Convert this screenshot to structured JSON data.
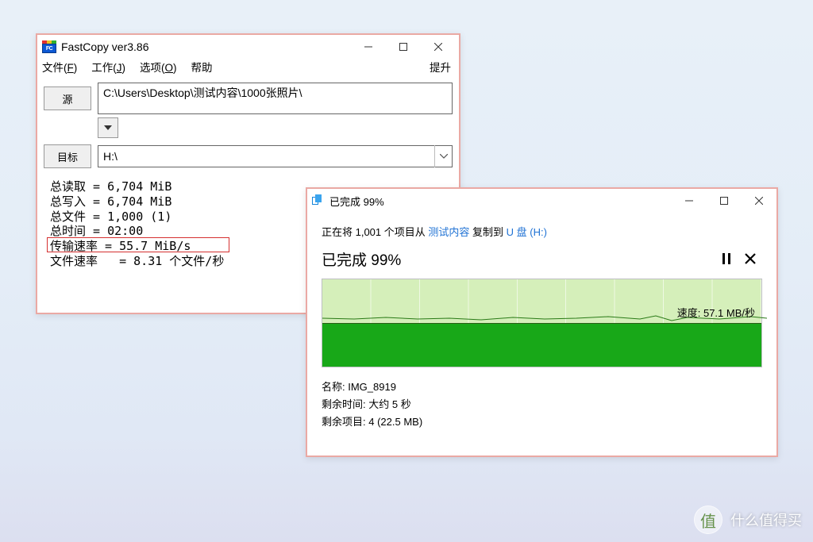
{
  "fastcopy": {
    "title": "FastCopy ver3.86",
    "menu": {
      "file": "文件(F)",
      "work": "工作(J)",
      "options": "选项(O)",
      "help": "帮助",
      "upgrade": "提升"
    },
    "source_btn": "源",
    "source_path": "C:\\Users\\Desktop\\测试内容\\1000张照片\\",
    "target_btn": "目标",
    "target_path": "H:\\",
    "stats": {
      "total_read_label": "总读取",
      "total_read_value": "6,704 MiB",
      "total_write_label": "总写入",
      "total_write_value": "6,704 MiB",
      "total_files_label": "总文件",
      "total_files_value": "1,000 (1)",
      "total_time_label": "总时间",
      "total_time_value": "02:00",
      "transfer_rate_label": "传输速率",
      "transfer_rate_value": "55.7 MiB/s",
      "file_rate_label": "文件速率",
      "file_rate_value": "8.31 个文件/秒"
    }
  },
  "copydialog": {
    "title": "已完成 99%",
    "msg_prefix": "正在将 1,001 个项目从 ",
    "msg_source": "测试内容",
    "msg_mid": " 复制到 ",
    "msg_dest": "U 盘 (H:)",
    "status": "已完成 99%",
    "speed": "速度: 57.1 MB/秒",
    "detail_name_label": "名称: ",
    "detail_name_value": "IMG_8919",
    "detail_time_label": "剩余时间: ",
    "detail_time_value": "大约 5 秒",
    "detail_items_label": "剩余项目: ",
    "detail_items_value": "4 (22.5 MB)"
  },
  "watermark": {
    "icon": "值",
    "text": "什么值得买"
  },
  "chart_data": {
    "type": "area",
    "title": "File Copy Throughput",
    "ylabel": "MB/s",
    "ylim": [
      0,
      114
    ],
    "current_speed_mb_s": 57.1,
    "series": [
      {
        "name": "Speed",
        "values": [
          57,
          57,
          57,
          57,
          57,
          56,
          57,
          57,
          57,
          58,
          57,
          56,
          57,
          57,
          57,
          56,
          57,
          57,
          57,
          57
        ]
      }
    ]
  }
}
